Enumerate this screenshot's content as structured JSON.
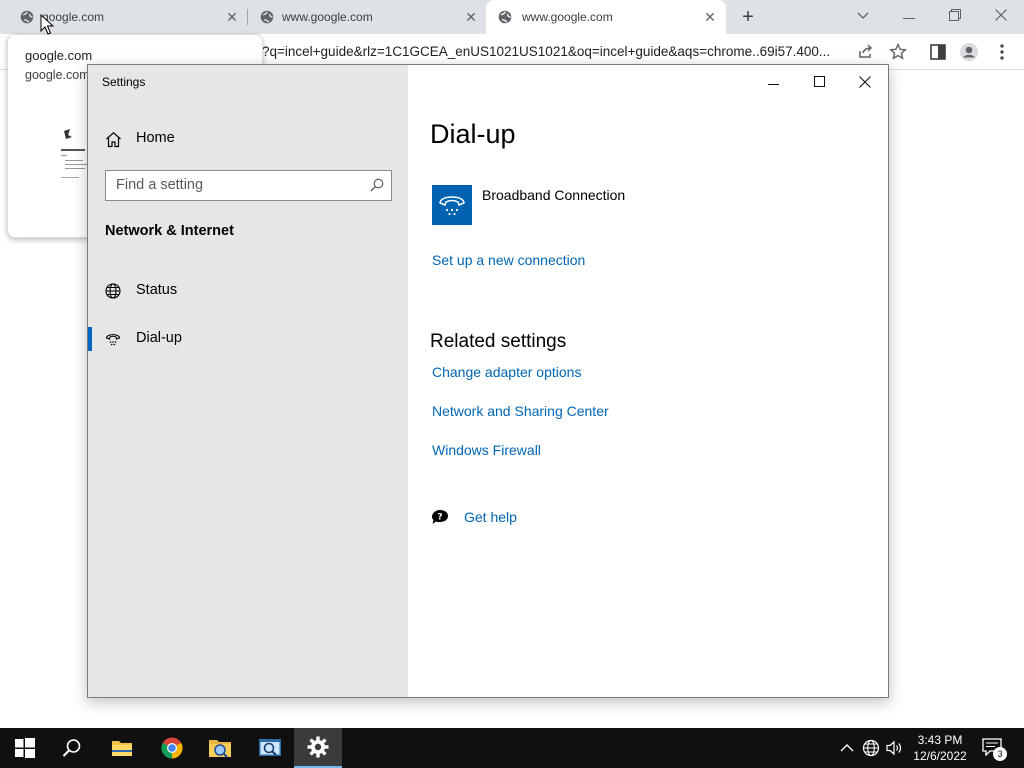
{
  "browser": {
    "tabs": [
      {
        "label": "google.com"
      },
      {
        "label": "www.google.com"
      },
      {
        "label": "www.google.com"
      }
    ],
    "url": "?q=incel+guide&rlz=1C1GCEA_enUS1021US1021&oq=incel+guide&aqs=chrome..69i57.400...",
    "hovercard": {
      "title": "google.com",
      "domain": "google.com"
    }
  },
  "settings": {
    "window_title": "Settings",
    "home_label": "Home",
    "search_placeholder": "Find a setting",
    "section": "Network & Internet",
    "nav": [
      {
        "label": "Status",
        "icon": "globe-icon"
      },
      {
        "label": "Dial-up",
        "icon": "dialup-icon",
        "selected": true
      }
    ],
    "page_title": "Dial-up",
    "connection_name": "Broadband Connection",
    "setup_link": "Set up a new connection",
    "related_title": "Related settings",
    "related_links": [
      "Change adapter options",
      "Network and Sharing Center",
      "Windows Firewall"
    ],
    "help_label": "Get help",
    "accent_color": "#0067c0"
  },
  "taskbar": {
    "time": "3:43 PM",
    "date": "12/6/2022",
    "notification_count": "3"
  }
}
